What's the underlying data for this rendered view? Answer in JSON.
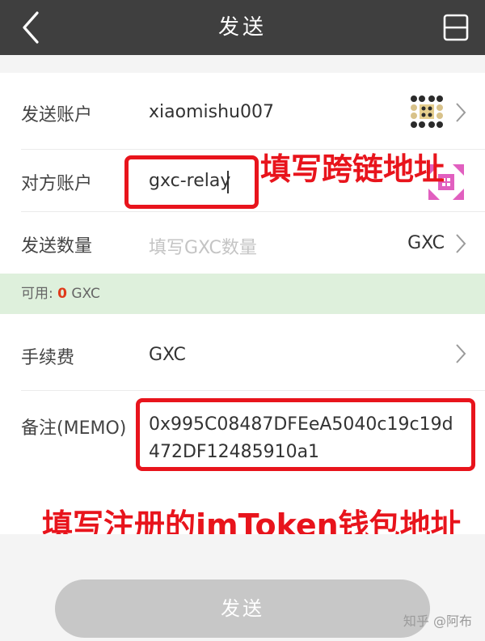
{
  "header": {
    "title": "发送"
  },
  "form": {
    "send_account": {
      "label": "发送账户",
      "value": "xiaomishu007"
    },
    "to_account": {
      "label": "对方账户",
      "value": "gxc-relay"
    },
    "amount": {
      "label": "发送数量",
      "placeholder": "填写GXC数量",
      "unit": "GXC"
    },
    "available": {
      "label": "可用: ",
      "amount": "0",
      "unit": " GXC"
    },
    "fee": {
      "label": "手续费",
      "value": "GXC"
    },
    "memo": {
      "label": "备注(MEMO)",
      "value": "0x995C08487DFEeA5040c19c19d472DF12485910a1"
    }
  },
  "annotations": {
    "cross_chain": "填写跨链地址",
    "imtoken": "填写注册的imToken钱包地址"
  },
  "footer": {
    "send_label": "发送",
    "watermark": "知乎 @阿布"
  },
  "colors": {
    "header_bg": "#3f3f3f",
    "highlight": "#e8141c",
    "available_bg": "#def0dc",
    "button_bg": "#c7c7c7"
  }
}
